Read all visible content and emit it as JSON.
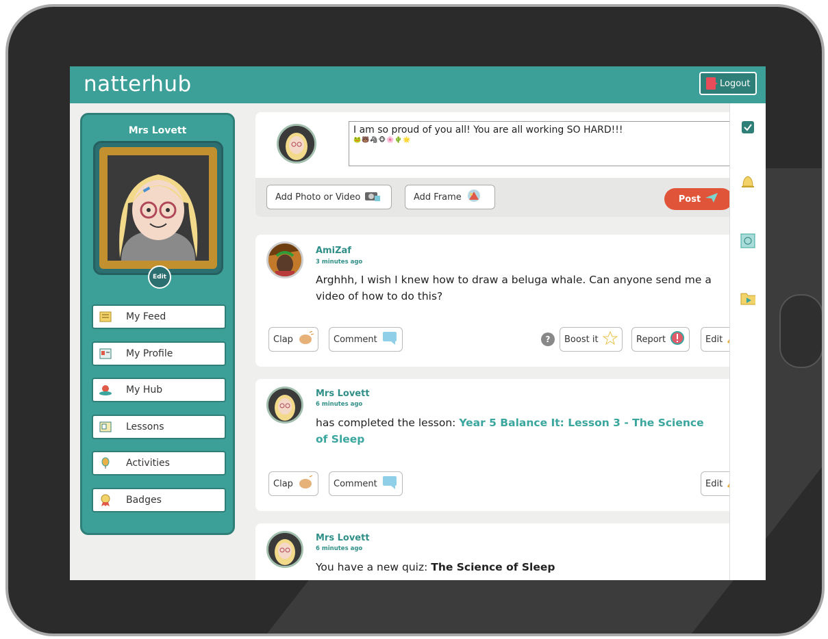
{
  "app": {
    "name": "natterhub"
  },
  "header": {
    "logout_label": "Logout"
  },
  "profile": {
    "name": "Mrs Lovett",
    "edit_label": "Edit"
  },
  "nav": {
    "items": [
      {
        "label": "My Feed",
        "icon": "feed-icon"
      },
      {
        "label": "My Profile",
        "icon": "profile-card-icon"
      },
      {
        "label": "My Hub",
        "icon": "hub-icon"
      },
      {
        "label": "Lessons",
        "icon": "lessons-icon"
      },
      {
        "label": "Activities",
        "icon": "balloon-icon"
      },
      {
        "label": "Badges",
        "icon": "badge-icon"
      }
    ]
  },
  "composer": {
    "text": "I am so proud of you all! You are all working SO HARD!!!",
    "emojis": "🐸🐻🦓🐵🌸🌵🌟",
    "add_media_label": "Add Photo or Video",
    "add_frame_label": "Add Frame",
    "post_label": "Post"
  },
  "feed": [
    {
      "user": "AmiZaf",
      "time": "3 minutes ago",
      "body": "Arghhh, I wish I knew how to draw a beluga whale. Can anyone send me a video of how to do this?",
      "actions": {
        "clap": "Clap",
        "comment": "Comment",
        "boost": "Boost it",
        "report": "Report",
        "edit": "Edit",
        "help": "?"
      }
    },
    {
      "user": "Mrs Lovett",
      "time": "6 minutes ago",
      "body_prefix": "has completed the lesson: ",
      "body_link": "Year 5 Balance It: Lesson 3 - The Science of Sleep",
      "actions": {
        "clap": "Clap",
        "comment": "Comment",
        "edit": "Edit"
      }
    },
    {
      "user": "Mrs Lovett",
      "time": "6 minutes ago",
      "body_prefix": "You have a new quiz: ",
      "body_bold": "The Science of Sleep"
    }
  ],
  "colors": {
    "brand_teal": "#3c9f98",
    "post_button": "#e0553a",
    "logout_icon": "#e84b5a"
  },
  "rail": {
    "icons": [
      "checkbox-icon",
      "bell-icon",
      "snowflake-icon",
      "play-folder-icon"
    ]
  }
}
